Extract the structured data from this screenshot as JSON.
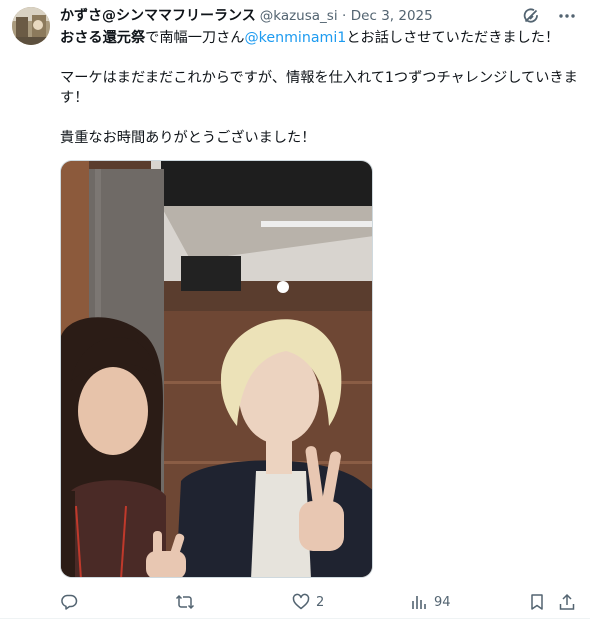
{
  "tweet": {
    "author": {
      "display_name": "かずさ@シンママフリーランス",
      "handle": "@kazusa_si",
      "separator": "·",
      "date": "Dec 3, 2025"
    },
    "text": {
      "line1_bold": "おさる還元祭",
      "line1_a": "で南幅一刀さん",
      "line1_mention": "@kenminami1",
      "line1_b": "とお話しさせていただきました！",
      "para2": "マーケはまだまだこれからですが、情報を仕入れて1つずつチャレンジしていきます！",
      "para3": "貴重なお時間ありがとうございました！"
    },
    "metrics": {
      "replies": "",
      "reposts": "",
      "likes": "2",
      "views": "94"
    },
    "icons": {
      "grok": "grok-icon",
      "more": "more-icon",
      "reply": "reply-icon",
      "repost": "repost-icon",
      "like": "heart-icon",
      "views": "views-icon",
      "bookmark": "bookmark-icon",
      "share": "share-icon"
    },
    "colors": {
      "text": "#0f1419",
      "secondary": "#536471",
      "link": "#1d9bf0"
    }
  }
}
